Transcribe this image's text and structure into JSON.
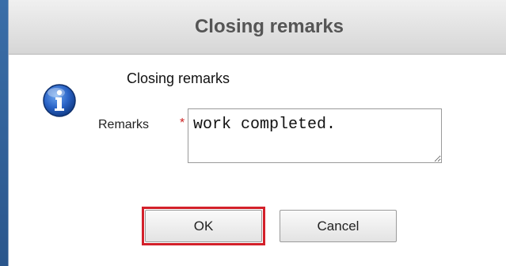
{
  "dialog": {
    "title": "Closing remarks",
    "heading": "Closing remarks",
    "icon": "info-icon"
  },
  "form": {
    "remarks_label": "Remarks",
    "required_marker": "*",
    "remarks_value": "work completed."
  },
  "buttons": {
    "ok_label": "OK",
    "cancel_label": "Cancel"
  },
  "colors": {
    "required": "#cc2222",
    "highlight": "#d3202a",
    "window_frame": "#2f5f98"
  }
}
